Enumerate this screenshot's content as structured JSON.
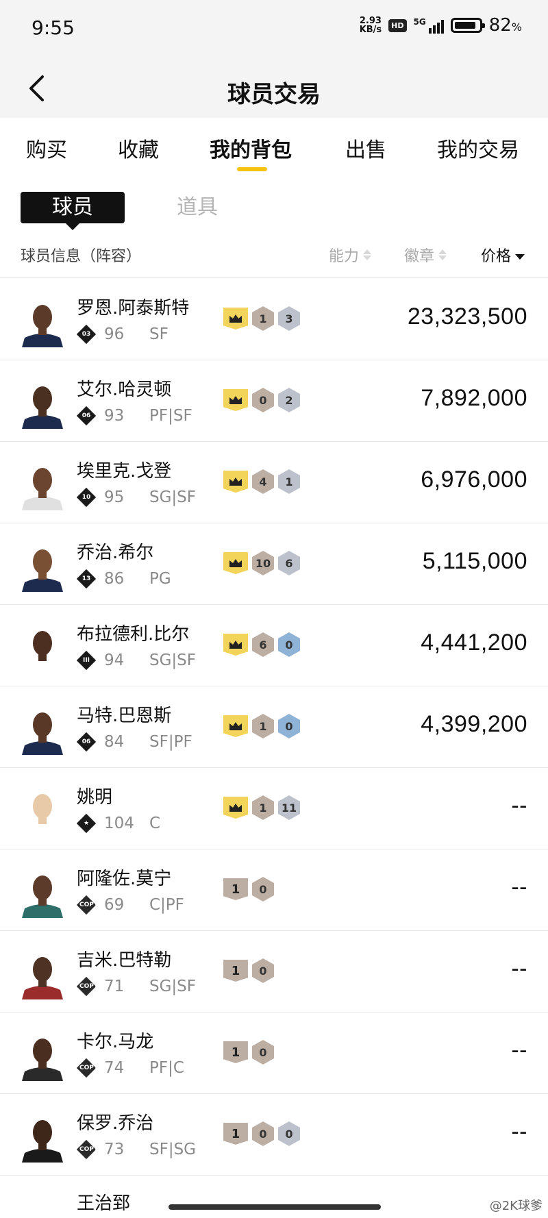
{
  "status_bar": {
    "time": "9:55",
    "net_speed_value": "2.93",
    "net_speed_unit": "KB/s",
    "hd": "HD",
    "network": "5G",
    "battery": "82",
    "battery_unit": "%"
  },
  "nav": {
    "back_icon": "chevron-left-icon",
    "title": "球员交易"
  },
  "tabs": [
    {
      "label": "购买",
      "active": false
    },
    {
      "label": "收藏",
      "active": false
    },
    {
      "label": "我的背包",
      "active": true
    },
    {
      "label": "出售",
      "active": false
    },
    {
      "label": "我的交易",
      "active": false
    }
  ],
  "segments": {
    "players": "球员",
    "items": "道具"
  },
  "list_header": {
    "info": "球员信息（阵容）",
    "ability": "能力",
    "badges": "徽章",
    "price": "价格"
  },
  "players": [
    {
      "name": "罗恩.阿泰斯特",
      "tier": "03",
      "ovr": "96",
      "pos": "SF",
      "crown": true,
      "badges": [
        {
          "v": "1",
          "t": "bronze"
        },
        {
          "v": "3",
          "t": "silver"
        }
      ],
      "price": "23,323,500"
    },
    {
      "name": "艾尔.哈灵顿",
      "tier": "06",
      "ovr": "93",
      "pos": "PF|SF",
      "crown": true,
      "badges": [
        {
          "v": "0",
          "t": "bronze"
        },
        {
          "v": "2",
          "t": "silver"
        }
      ],
      "price": "7,892,000"
    },
    {
      "name": "埃里克.戈登",
      "tier": "10",
      "ovr": "95",
      "pos": "SG|SF",
      "crown": true,
      "badges": [
        {
          "v": "4",
          "t": "bronze"
        },
        {
          "v": "1",
          "t": "silver"
        }
      ],
      "price": "6,976,000"
    },
    {
      "name": "乔治.希尔",
      "tier": "13",
      "ovr": "86",
      "pos": "PG",
      "crown": true,
      "badges": [
        {
          "v": "10",
          "t": "bronze"
        },
        {
          "v": "6",
          "t": "silver"
        }
      ],
      "price": "5,115,000"
    },
    {
      "name": "布拉德利.比尔",
      "tier": "III",
      "ovr": "94",
      "pos": "SG|SF",
      "crown": true,
      "badges": [
        {
          "v": "6",
          "t": "bronze"
        },
        {
          "v": "0",
          "t": "blue"
        }
      ],
      "price": "4,441,200"
    },
    {
      "name": "马特.巴恩斯",
      "tier": "06",
      "ovr": "84",
      "pos": "SF|PF",
      "crown": true,
      "badges": [
        {
          "v": "1",
          "t": "bronze"
        },
        {
          "v": "0",
          "t": "blue"
        }
      ],
      "price": "4,399,200"
    },
    {
      "name": "姚明",
      "tier": "★",
      "ovr": "104",
      "pos": "C",
      "crown": true,
      "badges": [
        {
          "v": "1",
          "t": "bronze"
        },
        {
          "v": "11",
          "t": "silver"
        }
      ],
      "price": "--"
    },
    {
      "name": "阿隆佐.莫宁",
      "tier": "COPY",
      "ovr": "69",
      "pos": "C|PF",
      "crown": false,
      "shield": "1",
      "badges": [
        {
          "v": "0",
          "t": "bronze"
        }
      ],
      "price": "--"
    },
    {
      "name": "吉米.巴特勒",
      "tier": "COPY",
      "ovr": "71",
      "pos": "SG|SF",
      "crown": false,
      "shield": "1",
      "badges": [
        {
          "v": "0",
          "t": "bronze"
        }
      ],
      "price": "--"
    },
    {
      "name": "卡尔.马龙",
      "tier": "COPY",
      "ovr": "74",
      "pos": "PF|C",
      "crown": false,
      "shield": "1",
      "badges": [
        {
          "v": "0",
          "t": "bronze"
        }
      ],
      "price": "--"
    },
    {
      "name": "保罗.乔治",
      "tier": "COPY",
      "ovr": "73",
      "pos": "SF|SG",
      "crown": false,
      "shield": "1",
      "badges": [
        {
          "v": "0",
          "t": "bronze"
        },
        {
          "v": "0",
          "t": "silver"
        }
      ],
      "price": "--"
    }
  ],
  "partial_row_name": "王治郅",
  "watermark": "@2K球爹",
  "colors": {
    "accent": "#f6c313",
    "crown": "#f3d45a",
    "bronze": "#bdaea3",
    "silver": "#bcc1cb",
    "blue": "#8fb3d6"
  }
}
